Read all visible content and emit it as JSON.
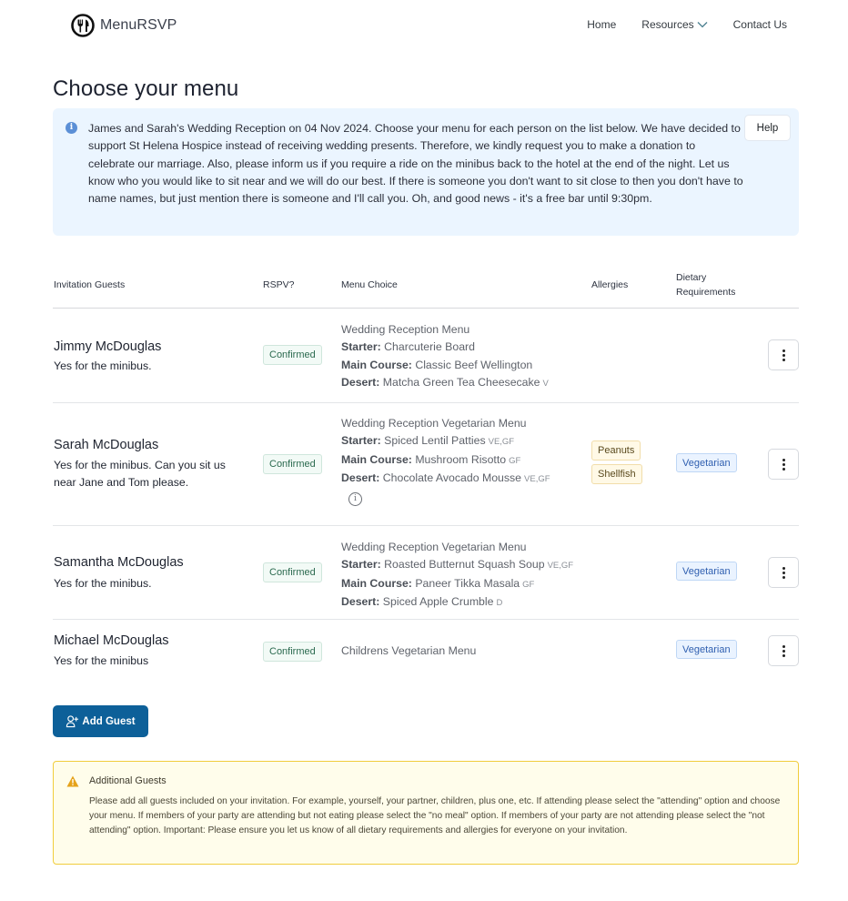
{
  "brand": {
    "name": "MenuRSVP",
    "icon": "cutlery-icon"
  },
  "nav": [
    {
      "label": "Home"
    },
    {
      "label": "Resources",
      "icon": "chevron-down-icon"
    },
    {
      "label": "Contact Us"
    }
  ],
  "page_title": "Choose your menu",
  "info": {
    "icon": "info-icon",
    "text": "James and Sarah's Wedding Reception on 04 Nov 2024. Choose your menu for each person on the list below. We have decided to support St Helena Hospice instead of receiving wedding presents. Therefore, we kindly request you to make a donation to celebrate our marriage. Also, please inform us if you require a ride on the minibus back to the hotel at the end of the night. Let us know who you would like to sit near and we will do our best. If there is someone you don't want to sit close to then you don't have to name names, but just mention there is someone and I'll call you. Oh, and good news - it's a free bar until 9:30pm.",
    "help_label": "Help"
  },
  "table": {
    "headers": {
      "guests": "Invitation Guests",
      "rsvp": "RSPV?",
      "menu": "Menu Choice",
      "allergies": "Allergies",
      "dietary_line1": "Dietary",
      "dietary_line2": "Requirements"
    },
    "rows": [
      {
        "name": "Jimmy McDouglas",
        "note": "Yes for the minibus.",
        "rsvp": "Confirmed",
        "menu_title": "Wedding Reception Menu",
        "starter_label": "Starter:",
        "starter": "Charcuterie Board",
        "starter_tags": "",
        "main_label": "Main Course:",
        "main": "Classic Beef Wellington",
        "main_tags": "",
        "desert_label": "Desert:",
        "desert": "Matcha Green Tea Cheesecake",
        "desert_tags": "V",
        "allergies": [],
        "dietary": ""
      },
      {
        "name": "Sarah McDouglas",
        "note": "Yes for the minibus. Can you sit us near Jane and Tom please.",
        "rsvp": "Confirmed",
        "menu_title": "Wedding Reception Vegetarian Menu",
        "starter_label": "Starter:",
        "starter": "Spiced Lentil Patties",
        "starter_tags": "VE,GF",
        "main_label": "Main Course:",
        "main": "Mushroom Risotto",
        "main_tags": "GF",
        "desert_label": "Desert:",
        "desert": "Chocolate Avocado Mousse",
        "desert_tags": "VE,GF",
        "allergies": [
          "Peanuts",
          "Shellfish"
        ],
        "dietary": "Vegetarian",
        "menu_info_icon": "info-circle-icon"
      },
      {
        "name": "Samantha McDouglas",
        "note": "Yes for the minibus.",
        "rsvp": "Confirmed",
        "menu_title": "Wedding Reception Vegetarian Menu",
        "starter_label": "Starter:",
        "starter": "Roasted Butternut Squash Soup",
        "starter_tags": "VE,GF",
        "main_label": "Main Course:",
        "main": "Paneer Tikka Masala",
        "main_tags": "GF",
        "desert_label": "Desert:",
        "desert": "Spiced Apple Crumble",
        "desert_tags": "D",
        "allergies": [],
        "dietary": "Vegetarian"
      },
      {
        "name": "Michael McDouglas",
        "note": "Yes for the minibus",
        "rsvp": "Confirmed",
        "menu_title": "Childrens Vegetarian Menu",
        "allergies": [],
        "dietary": "Vegetarian"
      }
    ]
  },
  "add_guest": {
    "label": "Add Guest",
    "icon": "user-plus-icon"
  },
  "warning": {
    "icon": "warning-icon",
    "title": "Additional Guests",
    "text": "Please add all guests included on your invitation. For example, yourself, your partner, children, plus one, etc. If attending please select the \"attending\" option and choose your menu. If members of your party are attending but not eating please select the \"no meal\" option. If members of your party are not attending please select the \"not attending\" option. Important: Please ensure you let us know of all dietary requirements and allergies for everyone on your invitation."
  },
  "colors": {
    "primary": "#0d6099",
    "info_bg": "#ebf5ff",
    "warning_bg": "#fffdeb",
    "warning_border": "#f1cd3d",
    "confirmed": "#2b6a4f",
    "dietary": "#2f5fb0"
  }
}
